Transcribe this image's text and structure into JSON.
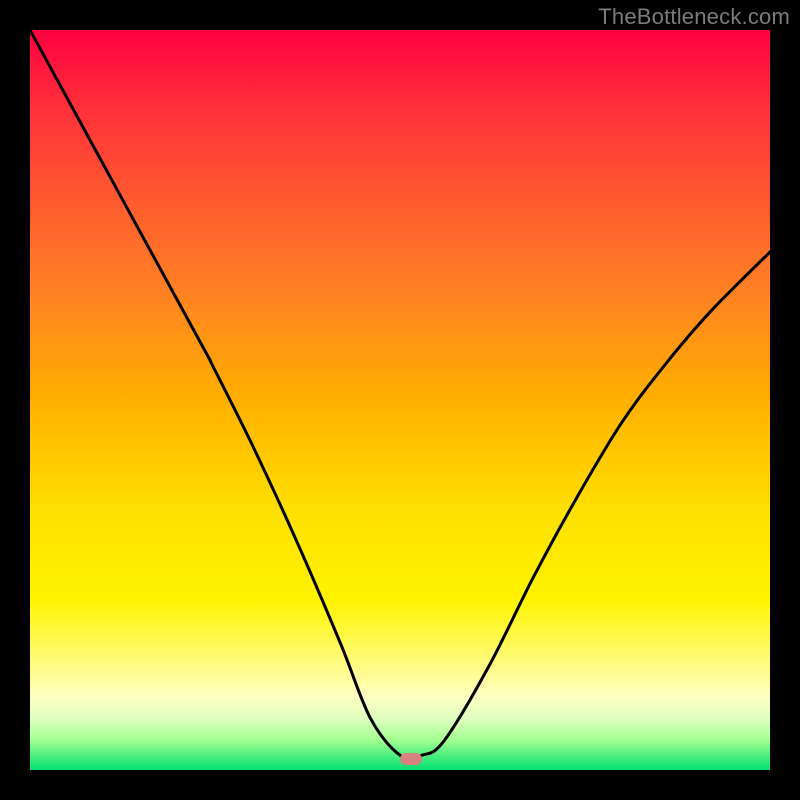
{
  "watermark": "TheBottleneck.com",
  "marker": {
    "x_frac": 0.515,
    "y_frac": 0.985
  },
  "chart_data": {
    "type": "line",
    "title": "",
    "xlabel": "",
    "ylabel": "",
    "xlim": [
      0,
      1
    ],
    "ylim": [
      0,
      1
    ],
    "series": [
      {
        "name": "bottleneck-curve",
        "x": [
          0.0,
          0.06,
          0.12,
          0.18,
          0.24,
          0.245,
          0.3,
          0.36,
          0.42,
          0.46,
          0.5,
          0.53,
          0.56,
          0.62,
          0.68,
          0.74,
          0.8,
          0.86,
          0.92,
          1.0
        ],
        "y": [
          1.0,
          0.89,
          0.78,
          0.67,
          0.56,
          0.55,
          0.44,
          0.31,
          0.17,
          0.07,
          0.02,
          0.02,
          0.04,
          0.14,
          0.26,
          0.37,
          0.47,
          0.55,
          0.62,
          0.7
        ]
      }
    ],
    "annotations": [
      {
        "type": "marker",
        "x": 0.515,
        "y": 0.015,
        "label": "optimal-point"
      }
    ],
    "background_gradient": {
      "top_color": "#ff0040",
      "bottom_color": "#00e070",
      "meaning": "background heat from bottleneck (top) to balanced (bottom)"
    }
  }
}
